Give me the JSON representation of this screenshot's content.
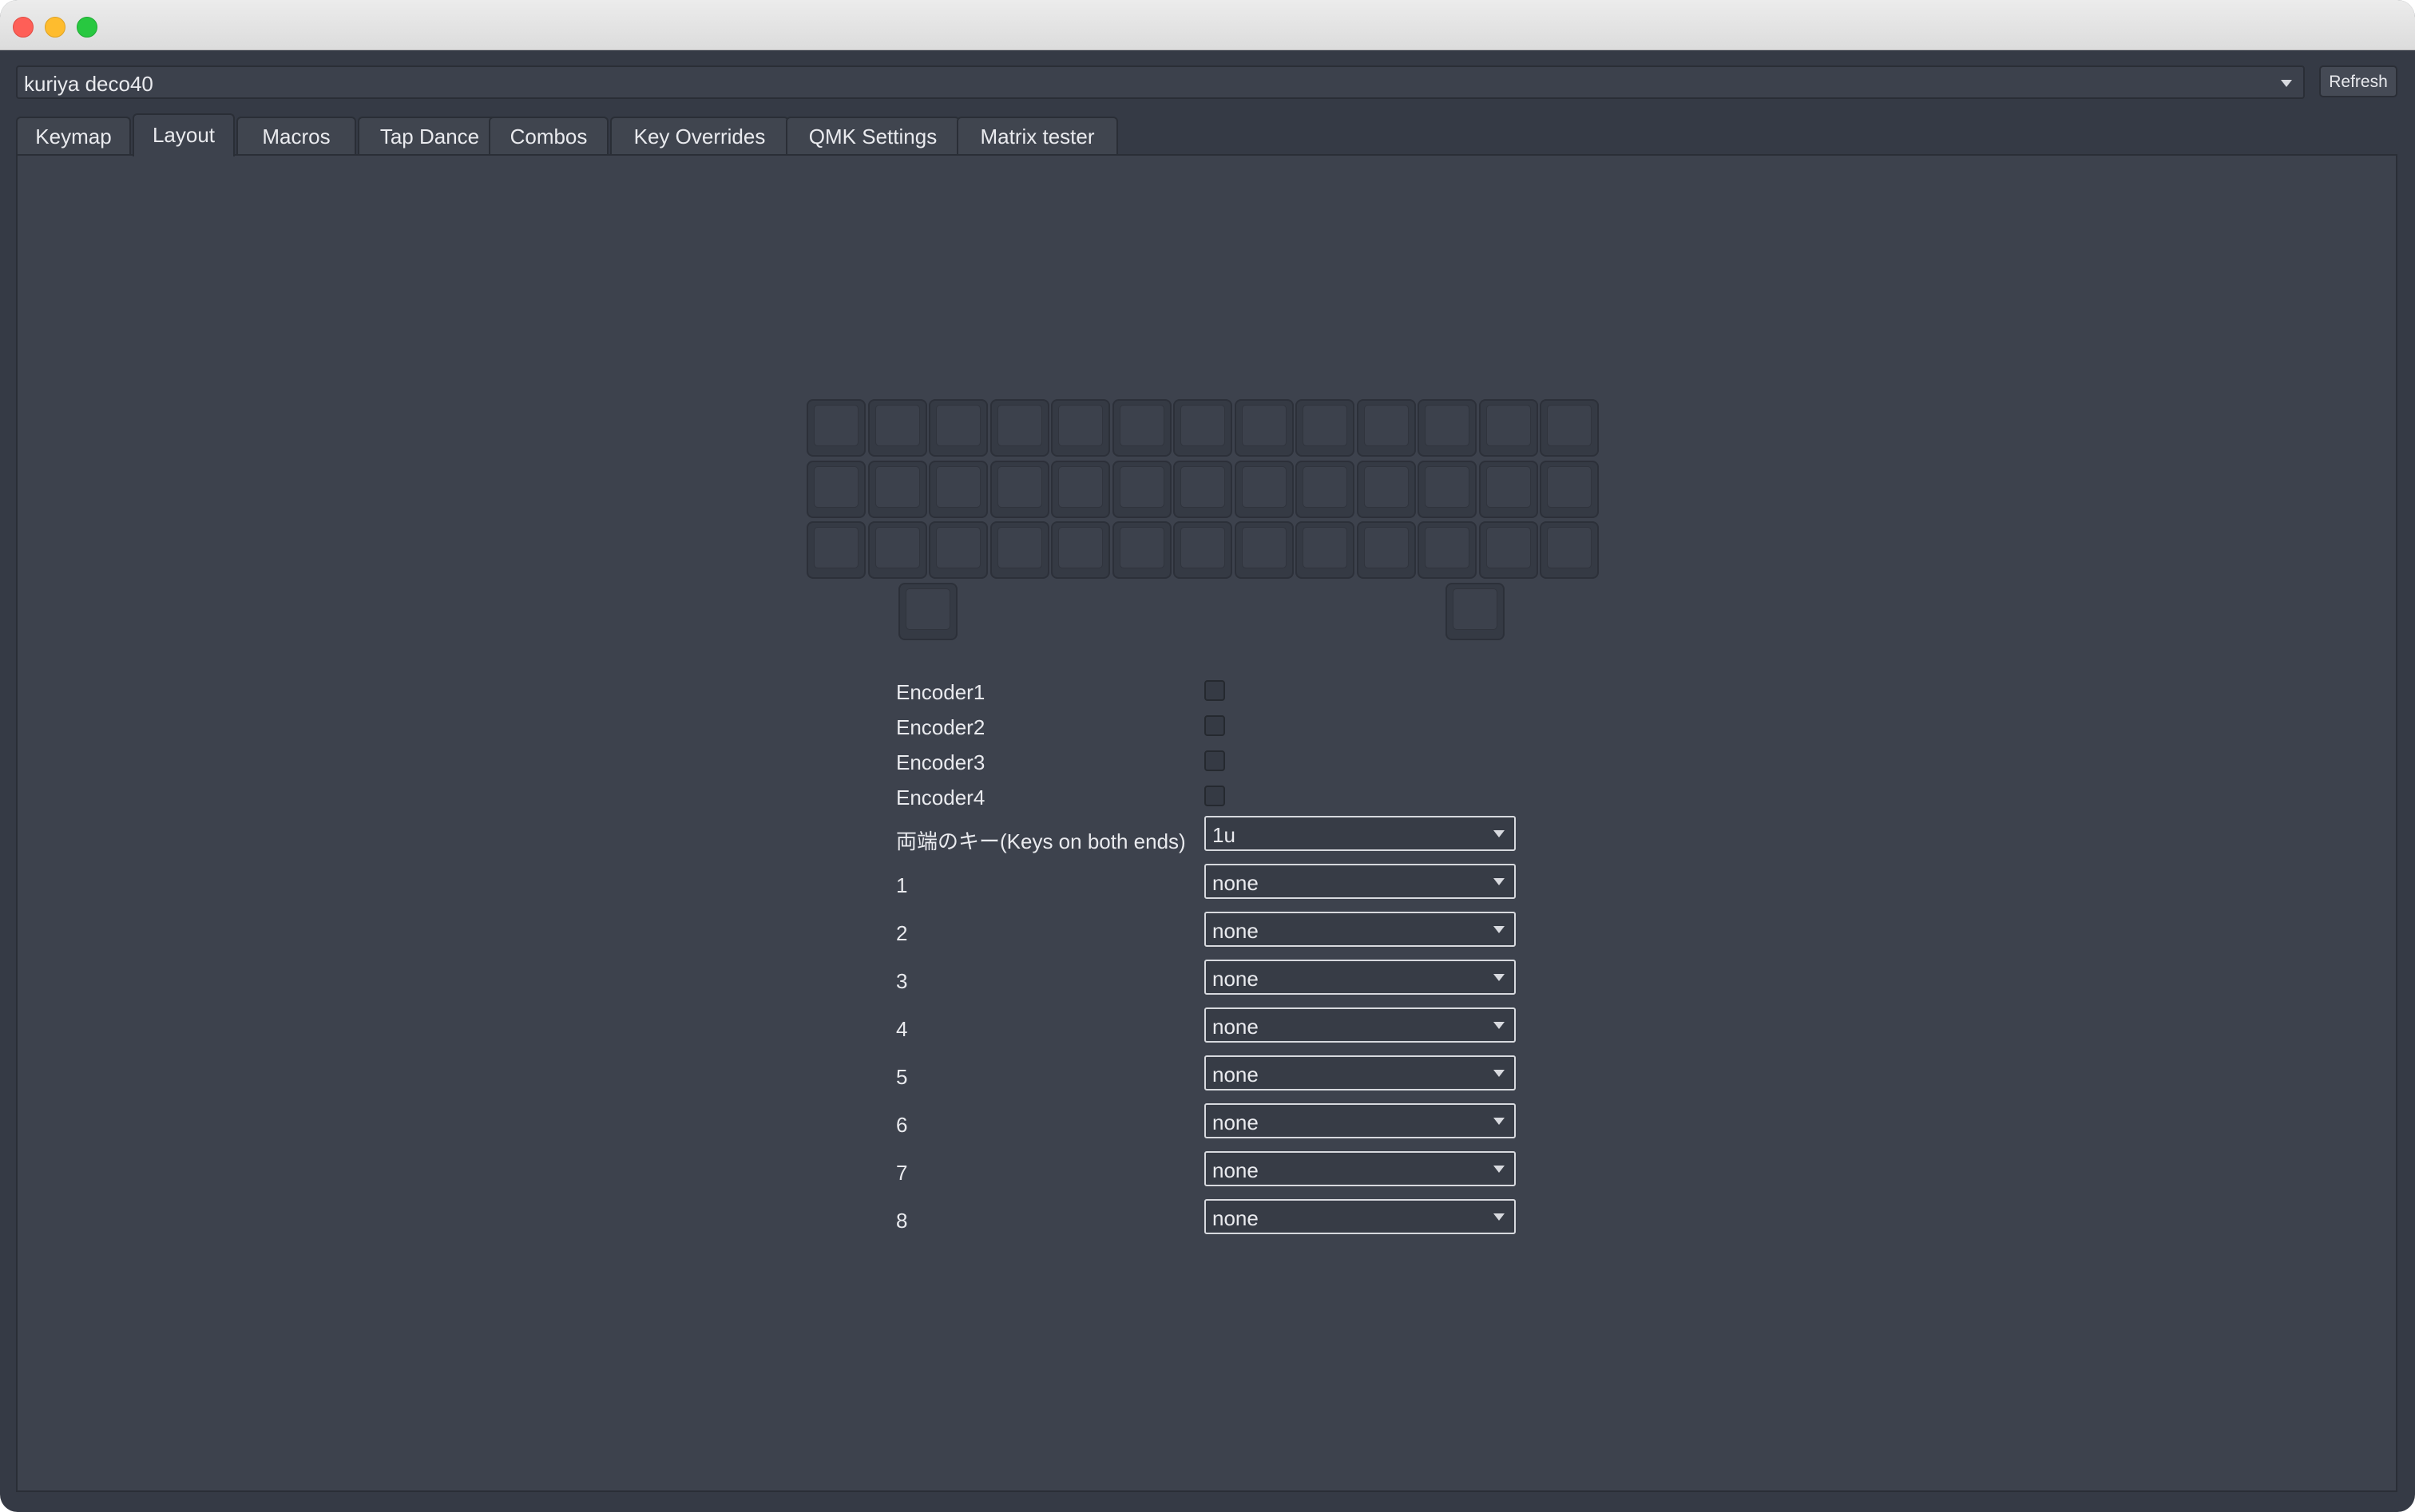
{
  "device_select": {
    "value": "kuriya deco40"
  },
  "refresh_label": "Refresh",
  "tabs": [
    {
      "label": "Keymap"
    },
    {
      "label": "Layout",
      "active": true
    },
    {
      "label": "Macros"
    },
    {
      "label": "Tap Dance"
    },
    {
      "label": "Combos"
    },
    {
      "label": "Key Overrides"
    },
    {
      "label": "QMK Settings"
    },
    {
      "label": "Matrix tester"
    }
  ],
  "layout_options": {
    "encoders": [
      {
        "label": "Encoder1",
        "checked": false
      },
      {
        "label": "Encoder2",
        "checked": false
      },
      {
        "label": "Encoder3",
        "checked": false
      },
      {
        "label": "Encoder4",
        "checked": false
      }
    ],
    "selects": [
      {
        "label": "両端のキー(Keys on both ends)",
        "value": "1u"
      },
      {
        "label": "1",
        "value": "none"
      },
      {
        "label": "2",
        "value": "none"
      },
      {
        "label": "3",
        "value": "none"
      },
      {
        "label": "4",
        "value": "none"
      },
      {
        "label": "5",
        "value": "none"
      },
      {
        "label": "6",
        "value": "none"
      },
      {
        "label": "7",
        "value": "none"
      },
      {
        "label": "8",
        "value": "none"
      }
    ]
  },
  "colors": {
    "window_bg": "#353a45",
    "panel_bg": "#3d424d",
    "text": "#e9eaee"
  }
}
